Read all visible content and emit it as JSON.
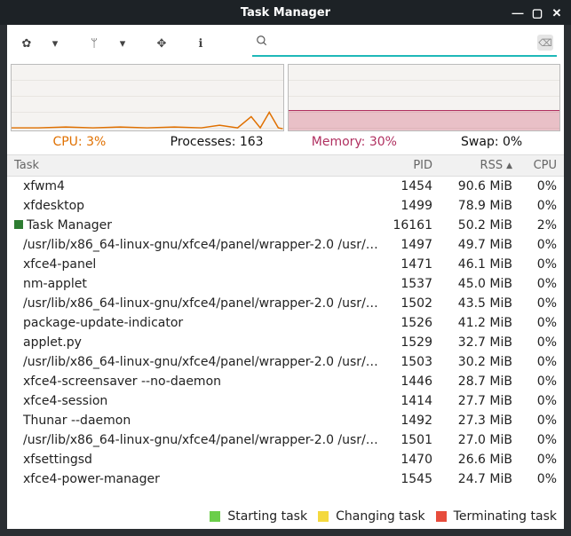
{
  "window": {
    "title": "Task Manager"
  },
  "search": {
    "placeholder": ""
  },
  "stats": {
    "cpu_label": "CPU: 3%",
    "proc_label": "Processes: 163",
    "mem_label": "Memory: 30%",
    "swap_label": "Swap: 0%"
  },
  "columns": {
    "task": "Task",
    "pid": "PID",
    "rss": "RSS",
    "cpu": "CPU"
  },
  "rows": [
    {
      "task": "xfwm4",
      "pid": "1454",
      "rss": "90.6 MiB",
      "cpu": "0%",
      "badge": false
    },
    {
      "task": "xfdesktop",
      "pid": "1499",
      "rss": "78.9 MiB",
      "cpu": "0%",
      "badge": false
    },
    {
      "task": "Task Manager",
      "pid": "16161",
      "rss": "50.2 MiB",
      "cpu": "2%",
      "badge": true
    },
    {
      "task": "/usr/lib/x86_64-linux-gnu/xfce4/panel/wrapper-2.0 /usr/lib/x8…",
      "pid": "1497",
      "rss": "49.7 MiB",
      "cpu": "0%",
      "badge": false
    },
    {
      "task": "xfce4-panel",
      "pid": "1471",
      "rss": "46.1 MiB",
      "cpu": "0%",
      "badge": false
    },
    {
      "task": "nm-applet",
      "pid": "1537",
      "rss": "45.0 MiB",
      "cpu": "0%",
      "badge": false
    },
    {
      "task": "/usr/lib/x86_64-linux-gnu/xfce4/panel/wrapper-2.0 /usr/lib/x8…",
      "pid": "1502",
      "rss": "43.5 MiB",
      "cpu": "0%",
      "badge": false
    },
    {
      "task": "package-update-indicator",
      "pid": "1526",
      "rss": "41.2 MiB",
      "cpu": "0%",
      "badge": false
    },
    {
      "task": "applet.py",
      "pid": "1529",
      "rss": "32.7 MiB",
      "cpu": "0%",
      "badge": false
    },
    {
      "task": "/usr/lib/x86_64-linux-gnu/xfce4/panel/wrapper-2.0 /usr/lib/x8…",
      "pid": "1503",
      "rss": "30.2 MiB",
      "cpu": "0%",
      "badge": false
    },
    {
      "task": "xfce4-screensaver --no-daemon",
      "pid": "1446",
      "rss": "28.7 MiB",
      "cpu": "0%",
      "badge": false
    },
    {
      "task": "xfce4-session",
      "pid": "1414",
      "rss": "27.7 MiB",
      "cpu": "0%",
      "badge": false
    },
    {
      "task": "Thunar --daemon",
      "pid": "1492",
      "rss": "27.3 MiB",
      "cpu": "0%",
      "badge": false
    },
    {
      "task": "/usr/lib/x86_64-linux-gnu/xfce4/panel/wrapper-2.0 /usr/lib/x8…",
      "pid": "1501",
      "rss": "27.0 MiB",
      "cpu": "0%",
      "badge": false
    },
    {
      "task": "xfsettingsd",
      "pid": "1470",
      "rss": "26.6 MiB",
      "cpu": "0%",
      "badge": false
    },
    {
      "task": "xfce4-power-manager",
      "pid": "1545",
      "rss": "24.7 MiB",
      "cpu": "0%",
      "badge": false
    }
  ],
  "legend": {
    "starting": "Starting task",
    "changing": "Changing task",
    "terminating": "Terminating task"
  }
}
